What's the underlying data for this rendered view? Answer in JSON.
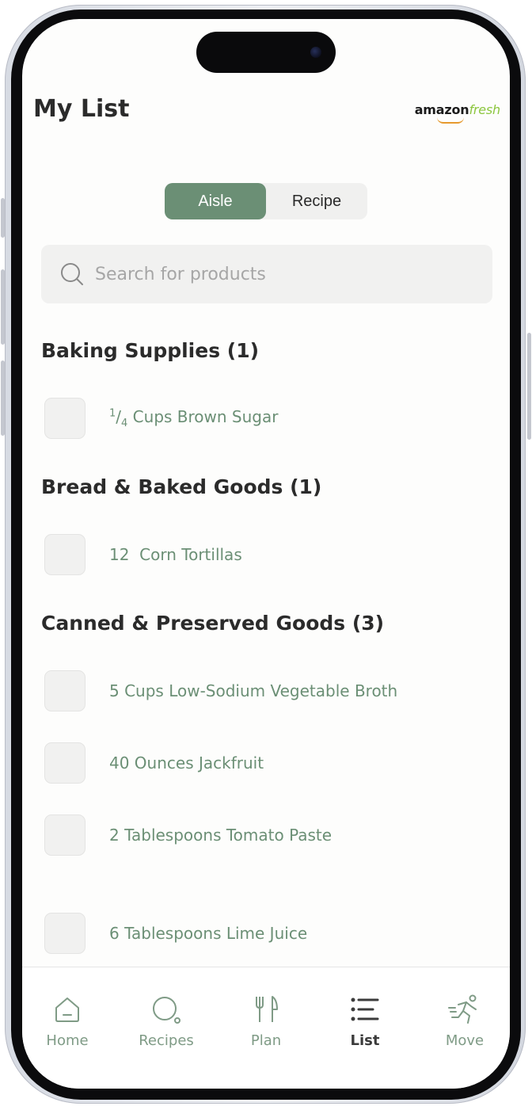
{
  "header": {
    "title": "My List",
    "brand_part1": "amazon",
    "brand_part2": "fresh"
  },
  "view_toggle": {
    "options": [
      "Aisle",
      "Recipe"
    ],
    "selected": "Aisle"
  },
  "search": {
    "placeholder": "Search for products",
    "value": ""
  },
  "sections": [
    {
      "title": "Baking Supplies (1)",
      "items": [
        {
          "fraction_num": "1",
          "fraction_den": "4",
          "label": "Cups Brown Sugar",
          "checked": false
        }
      ]
    },
    {
      "title": "Bread & Baked Goods (1)",
      "items": [
        {
          "label": "12  Corn Tortillas",
          "checked": false
        }
      ]
    },
    {
      "title": "Canned & Preserved Goods (3)",
      "items": [
        {
          "label": "5 Cups Low-Sodium Vegetable Broth",
          "checked": false
        },
        {
          "label": "40 Ounces Jackfruit",
          "checked": false
        },
        {
          "label": "2 Tablespoons Tomato Paste",
          "checked": false
        }
      ]
    },
    {
      "title": "",
      "items": [
        {
          "label": "6 Tablespoons Lime Juice",
          "checked": false
        }
      ]
    }
  ],
  "tab_bar": {
    "tabs": [
      {
        "label": "Home",
        "icon": "home-icon"
      },
      {
        "label": "Recipes",
        "icon": "recipes-icon"
      },
      {
        "label": "Plan",
        "icon": "fork-knife-icon"
      },
      {
        "label": "List",
        "icon": "list-icon",
        "active": true
      },
      {
        "label": "Move",
        "icon": "running-icon"
      }
    ]
  },
  "colors": {
    "accent": "#6b8f75",
    "item_text": "#6b8f75",
    "heading": "#2b2b2b",
    "tab_inactive": "#7f9b86",
    "tab_active": "#3b3b3b"
  }
}
